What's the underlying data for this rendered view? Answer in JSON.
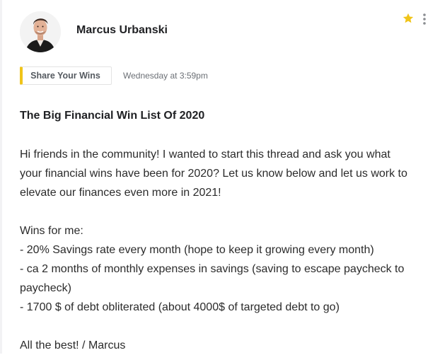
{
  "post": {
    "author": {
      "name": "Marcus Urbanski",
      "avatar_icon": "user-avatar"
    },
    "actions": {
      "star_icon": "star-icon",
      "star_color": "#f0c419",
      "more_icon": "more-vertical-icon"
    },
    "category": {
      "label": "Share Your Wins",
      "accent_color": "#f0c419"
    },
    "timestamp": "Wednesday at 3:59pm",
    "title": "The Big Financial Win List Of 2020",
    "body": {
      "intro_lines": [
        "Hi friends in the community! I wanted to start this thread and ask you what",
        "your financial wins have been for 2020? Let us know below and let us work to",
        "elevate our finances even more in 2021!"
      ],
      "wins_heading": "Wins for me:",
      "wins_lines": [
        "- 20% Savings rate every month (hope to keep it growing every month)",
        "- ca 2 months of monthly expenses in savings (saving to escape paycheck to",
        "paycheck)",
        "- 1700 $ of debt obliterated (about 4000$ of targeted debt to go)"
      ],
      "signoff": "All the best! / Marcus"
    }
  }
}
